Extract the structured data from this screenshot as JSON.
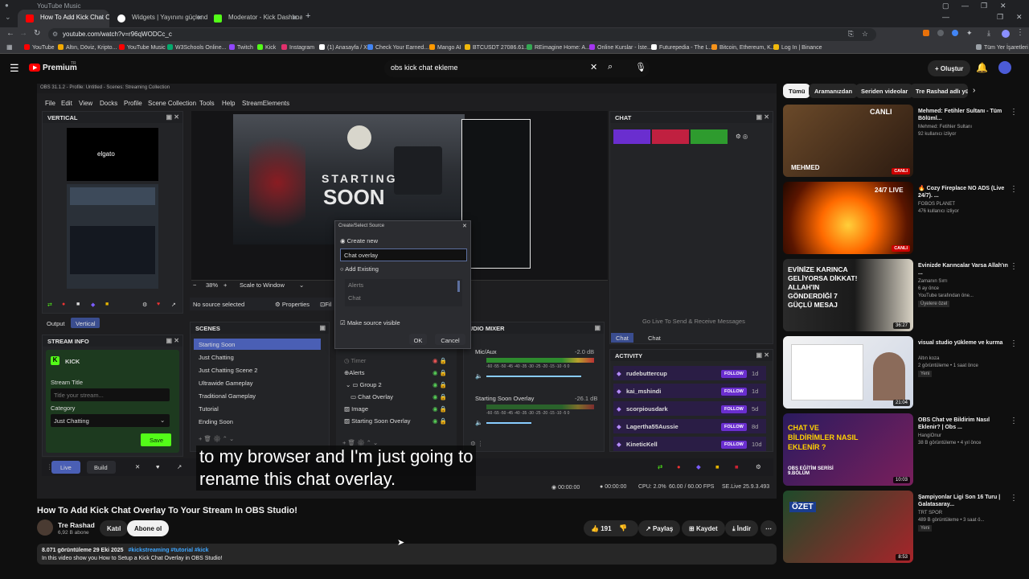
{
  "browser": {
    "window_title": "YouTube Music",
    "tabs": [
      {
        "label": "How To Add Kick Chat Overlay",
        "active": true,
        "color": "#ff0000"
      },
      {
        "label": "Widgets | Yayınını güçlendirme",
        "active": false,
        "color": "#ffffff"
      },
      {
        "label": "Moderator - Kick Dashboard",
        "active": false,
        "color": "#53fc18"
      }
    ],
    "url": "youtube.com/watch?v=r96qWODCc_c",
    "bookmarks": [
      {
        "label": "YouTube",
        "color": "#ff0000"
      },
      {
        "label": "Altın, Döviz, Kripto...",
        "color": "#f2a900"
      },
      {
        "label": "YouTube Music",
        "color": "#ff0000"
      },
      {
        "label": "W3Schools Online...",
        "color": "#04aa6d"
      },
      {
        "label": "Twitch",
        "color": "#9146ff"
      },
      {
        "label": "Kick",
        "color": "#53fc18"
      },
      {
        "label": "Instagram",
        "color": "#e1306c"
      },
      {
        "label": "(1) Anasayfa / X",
        "color": "#ffffff"
      },
      {
        "label": "Check Your Earned...",
        "color": "#4285f4"
      },
      {
        "label": "Mango AI",
        "color": "#ff9900"
      },
      {
        "label": "BTCUSDT 27086.61...",
        "color": "#f0b90b"
      },
      {
        "label": "REimagine Home: A...",
        "color": "#34a853"
      },
      {
        "label": "Online Kurslar - İste...",
        "color": "#a435f0"
      },
      {
        "label": "Futurepedia - The L...",
        "color": "#ffffff"
      },
      {
        "label": "Bitcoin, Ethereum, K...",
        "color": "#f7931a"
      },
      {
        "label": "Log In | Binance",
        "color": "#f0b90b"
      }
    ],
    "all_bookmarks_label": "Tüm Yer İşaretleri"
  },
  "youtube_header": {
    "logo": "Premium",
    "logo_sup": "TR",
    "search_value": "obs kick chat ekleme",
    "create_label": "Oluştur"
  },
  "obs": {
    "titlebar": "OBS 31.1.2 - Profile: Untitled - Scenes: Streaming Collection",
    "menu": [
      "File",
      "Edit",
      "View",
      "Docks",
      "Profile",
      "Scene Collection",
      "Tools",
      "Help",
      "StreamElements"
    ],
    "vertical_title": "VERTICAL",
    "elgato": "elgato",
    "output_tab": "Output",
    "vertical_tab": "Vertical",
    "stream_info_title": "STREAM INFO",
    "kick_label": "KICK",
    "stream_title_label": "Stream Title",
    "stream_title_placeholder": "Title your stream...",
    "category_label": "Category",
    "category_value": "Just Chatting",
    "save_label": "Save",
    "preview_text_1": "STARTING",
    "preview_text_2": "SOON",
    "zoom": "38%",
    "scale_mode": "Scale to Window",
    "no_source": "No source selected",
    "properties": "Properties",
    "filters": "Fil",
    "scenes_title": "SCENES",
    "scenes": [
      "Starting Soon",
      "Just Chatting",
      "Just Chatting Scene 2",
      "Ultrawide Gameplay",
      "Traditional Gameplay",
      "Tutorial",
      "Ending Soon"
    ],
    "sources": [
      "Timer",
      "Alerts",
      "Group 2",
      "Chat Overlay",
      "Image",
      "Starting Soon Overlay"
    ],
    "mixer_title": "UDIO MIXER",
    "mixer": [
      {
        "name": "Mic/Aux",
        "db": "-2.0 dB"
      },
      {
        "name": "Starting Soon Overlay",
        "db": "-26.1 dB"
      }
    ],
    "meter_scale": "-60 -55 -50 -45 -40 -35 -30 -25 -20 -15 -10 -5 0",
    "chat_title": "CHAT",
    "go_live_msg": "Go Live To Send & Receive Messages",
    "chat_tabs": [
      "Chat",
      "Chat"
    ],
    "activity_title": "ACTIVITY",
    "activity": [
      {
        "name": "rudebuttercup",
        "action": "FOLLOW",
        "age": "1d"
      },
      {
        "name": "kai_mshindi",
        "action": "FOLLOW",
        "age": "1d"
      },
      {
        "name": "scorpiousdark",
        "action": "FOLLOW",
        "age": "5d"
      },
      {
        "name": "Lagertha55Aussie",
        "action": "FOLLOW",
        "age": "8d"
      },
      {
        "name": "KineticKell",
        "action": "FOLLOW",
        "age": "10d"
      }
    ],
    "live_btn": "Live",
    "build_btn": "Build",
    "status": {
      "time1": "00:00:00",
      "time2": "00:00:00",
      "cpu": "CPU: 2.0%",
      "fps": "60.00 / 60.00 FPS",
      "se": "SE.Live 25.9.3.493"
    },
    "dialog": {
      "title": "Create/Select Source",
      "create_new": "Create new",
      "name_value": "Chat overlay",
      "add_existing": "Add Existing",
      "existing": [
        "Alerts",
        "Chat"
      ],
      "make_visible": "Make source visible",
      "ok": "OK",
      "cancel": "Cancel"
    }
  },
  "subtitle_line1": "to my browser and I'm just going to",
  "subtitle_line2": "rename this chat overlay.",
  "video_info": {
    "title": "How To Add Kick Chat Overlay To Your Stream In OBS Studio!",
    "channel": "Tre Rashad",
    "subscribers": "6,92 B abone",
    "join": "Katıl",
    "subscribe": "Abone ol",
    "likes": "191",
    "share": "Paylaş",
    "save": "Kaydet",
    "download": "İndir",
    "views_date": "8.071 görüntüleme  29 Eki 2025",
    "tags": "#kickstreaming #tutorial #kick",
    "description": "In this video show you How to Setup a Kick Chat Overlay in OBS Studio!"
  },
  "sidebar": {
    "chips": [
      "Tümü",
      "Aramanızdan",
      "Seriden videolar",
      "Tre Rashad adlı yük"
    ],
    "recs": [
      {
        "thumb_text": "CANLI",
        "overlay": "MEHMED",
        "title": "Mehmed: Fetihler Sultanı - Tüm Bölüml...",
        "channel": "Mehmed: Fetihler Sultanı",
        "meta": "92 kullanıcı izliyor",
        "badge": "CANLI",
        "badge_type": "live"
      },
      {
        "thumb_text": "24/7 LIVE",
        "overlay": "",
        "title": "🔥 Cozy Fireplace NO ADS (Live 24/7). ...",
        "channel": "FOBOS PLANET",
        "meta": "476 kullanıcı izliyor",
        "badge": "CANLI",
        "badge_type": "live"
      },
      {
        "thumb_text": "EVİNİZE KARINCA GELİYORSA DİKKAT! ALLAH'IN GÖNDERDİĞİ 7 GÜÇLÜ MESAJ",
        "overlay": "",
        "title": "Evinizde Karıncalar Varsa Allah'ın ...",
        "channel": "Zamanın Sırrı",
        "meta": "6 ay önce",
        "meta2": "YouTube tarafından öne...",
        "meta3": "Üyelere özel",
        "badge": "36:27",
        "badge_type": "dur"
      },
      {
        "thumb_text": "",
        "overlay": "",
        "title": "visual studio yükleme ve kurma",
        "channel": "Altın koza",
        "meta": "2 görüntüleme • 1 saat önce",
        "meta2": "Yeni",
        "badge": "21:04",
        "badge_type": "dur"
      },
      {
        "thumb_text": "CHAT VE BİLDİRİMLER NASIL EKLENİR ?",
        "overlay": "OBS EĞİTİM SERİSİ 9.BÖLÜM",
        "title": "OBS Chat ve Bildirim Nasıl Eklenir? | Obs ...",
        "channel": "HangiOnur",
        "meta": "38 B görüntüleme • 4 yıl önce",
        "badge": "10:03",
        "badge_type": "dur"
      },
      {
        "thumb_text": "ÖZET",
        "overlay": "",
        "title": "Şampiyonlar Ligi Son 16 Turu | Galatasaray...",
        "channel": "TRT SPOR",
        "meta": "489 B görüntüleme • 3 saat ö...",
        "meta2": "Yeni",
        "badge": "8:53",
        "badge_type": "dur"
      }
    ]
  }
}
